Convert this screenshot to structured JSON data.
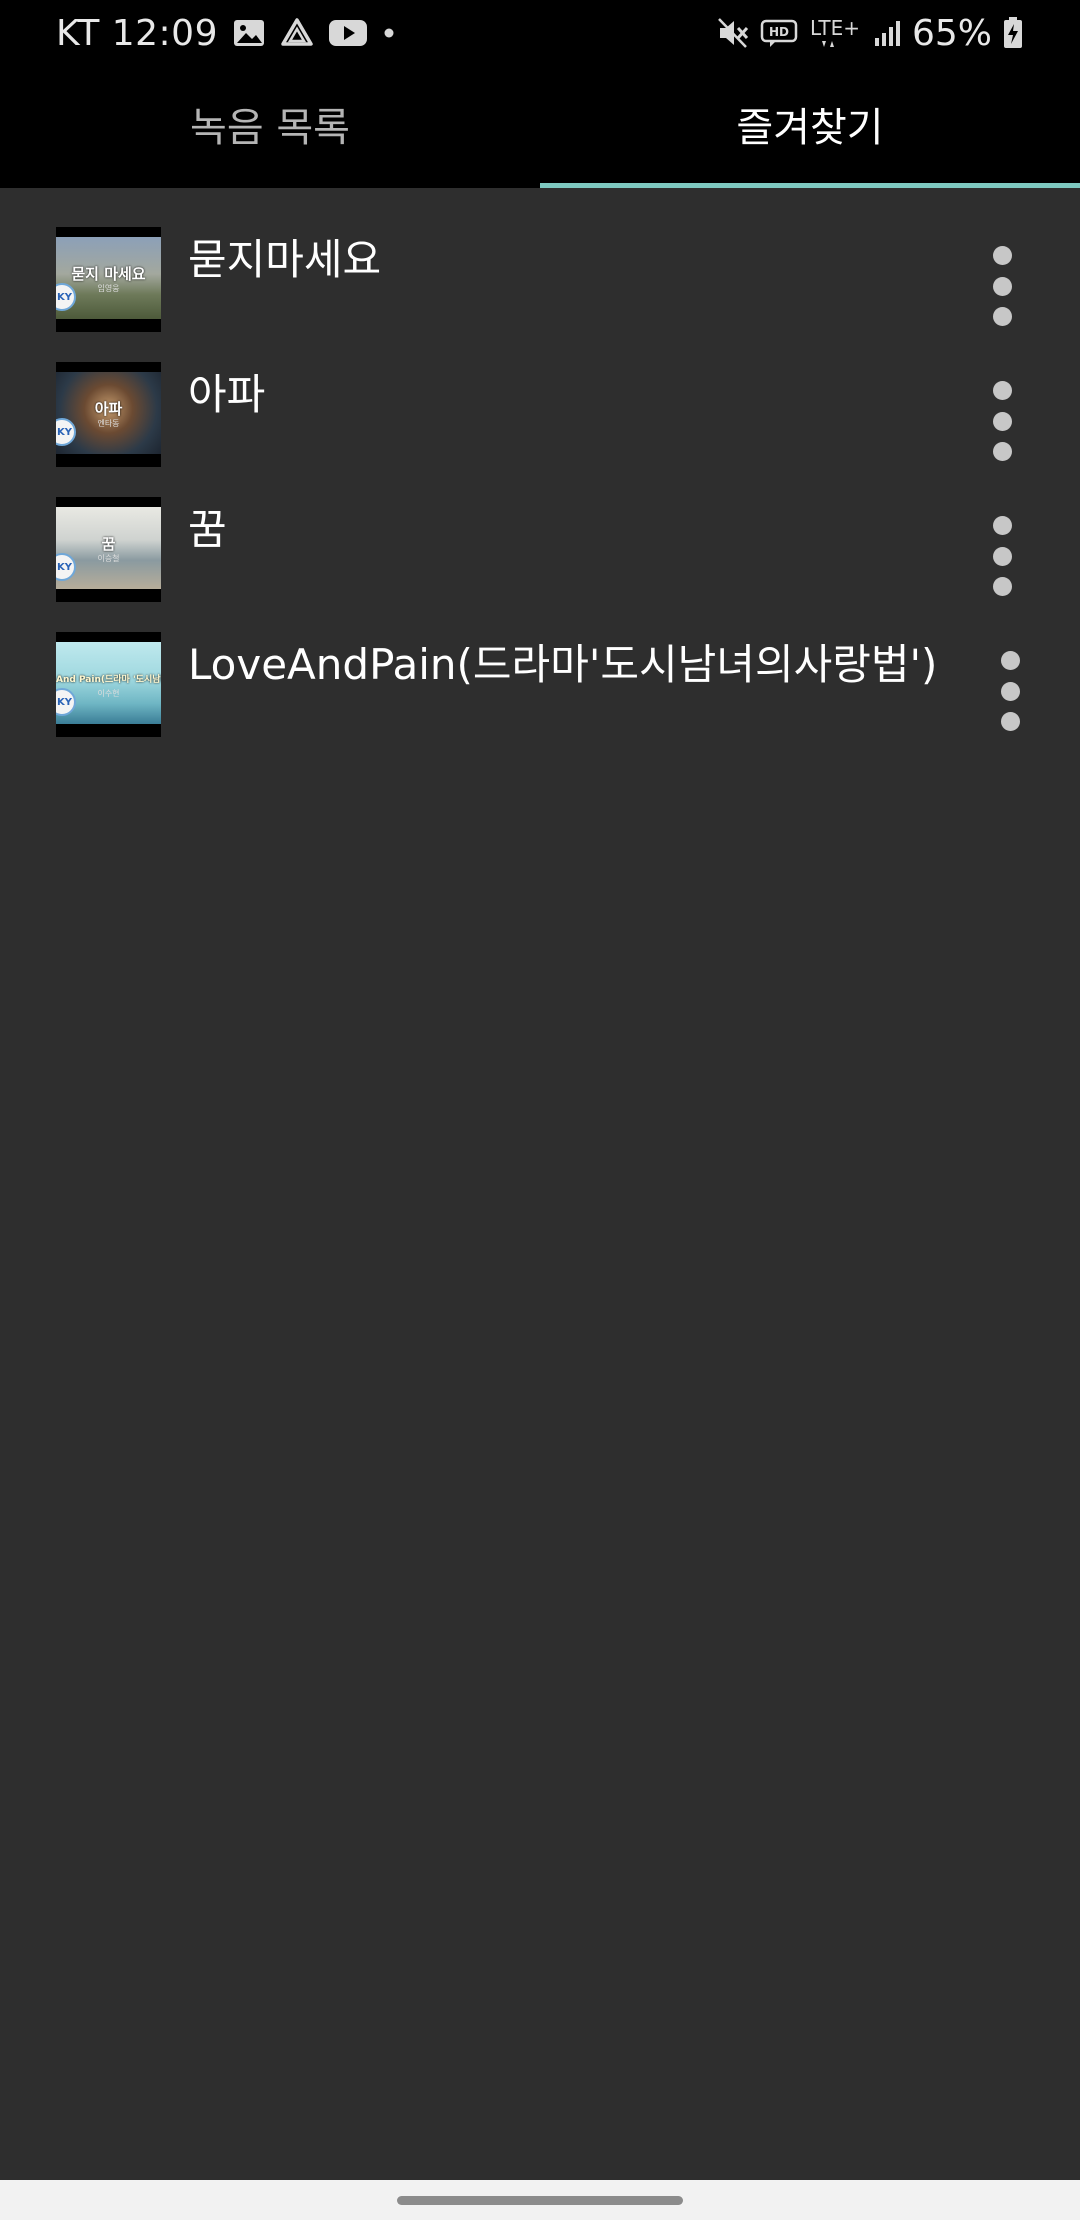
{
  "status_bar": {
    "carrier_time": "KT 12:09",
    "battery": "65%",
    "network": "LTE+",
    "hd_label": "HD"
  },
  "tabs": [
    {
      "label": "녹음 목록",
      "active": false
    },
    {
      "label": "즐겨찾기",
      "active": true
    }
  ],
  "accent_color": "#7ec8c0",
  "favorites": [
    {
      "title": "묻지마세요",
      "thumb_text": "묻지 마세요",
      "thumb_sub": "임영웅",
      "thumb_bg": "linear-gradient(180deg,#8ca0b8 0%,#a3a89e 45%,#6e7a5a 70%,#4d5a3a 100%)",
      "logo": "KY"
    },
    {
      "title": "아파",
      "thumb_text": "아파",
      "thumb_sub": "엔타동",
      "thumb_bg": "radial-gradient(circle at 50% 45%,#c49a6c 0%,#6b4a32 35%,#2c3a48 70%,#1d2530 100%)",
      "logo": "KY"
    },
    {
      "title": "꿈",
      "thumb_text": "꿈",
      "thumb_sub": "이승철",
      "thumb_bg": "linear-gradient(180deg,#e9e9e3 0%,#cfd3d0 40%,#8a9aa0 65%,#b7ad9a 100%)",
      "logo": "KY"
    },
    {
      "title": "LoveAndPain(드라마'도시남녀의사랑법')",
      "thumb_text": "And Pain(드라마 '도시남녀의 사",
      "thumb_sub": "이수현",
      "thumb_bg": "linear-gradient(180deg,#bfe9ee 0%,#9fd8df 45%,#6fb6c4 75%,#3a7d96 100%)",
      "logo": "KY"
    }
  ]
}
